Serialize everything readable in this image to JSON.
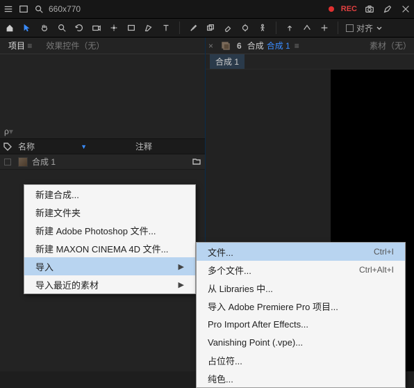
{
  "titlebar": {
    "search_value": "660x770",
    "rec_label": "REC"
  },
  "toolbar": {
    "align_label": "对齐"
  },
  "left": {
    "tab_project": "项目",
    "tab_effects": "效果控件（无）",
    "search_placeholder": "ρ",
    "col_name": "名称",
    "col_comment": "注释",
    "row1": {
      "name": "合成 1"
    }
  },
  "right": {
    "tab_comp": "合成",
    "comp_name": "合成 1",
    "tab_material": "素材（无）",
    "subtab": "合成 1"
  },
  "context_menu_1": {
    "items": [
      "新建合成...",
      "新建文件夹",
      "新建 Adobe Photoshop 文件...",
      "新建 MAXON CINEMA 4D 文件..."
    ],
    "import": "导入",
    "import_recent": "导入最近的素材"
  },
  "context_menu_2": {
    "file": {
      "label": "文件...",
      "shortcut": "Ctrl+I"
    },
    "multi_file": {
      "label": "多个文件...",
      "shortcut": "Ctrl+Alt+I"
    },
    "from_lib": "从 Libraries 中...",
    "premiere": "导入 Adobe Premiere Pro 项目...",
    "pro_import": "Pro Import After Effects...",
    "vanishing": "Vanishing Point (.vpe)...",
    "placeholder": "占位符...",
    "solid": "纯色..."
  }
}
